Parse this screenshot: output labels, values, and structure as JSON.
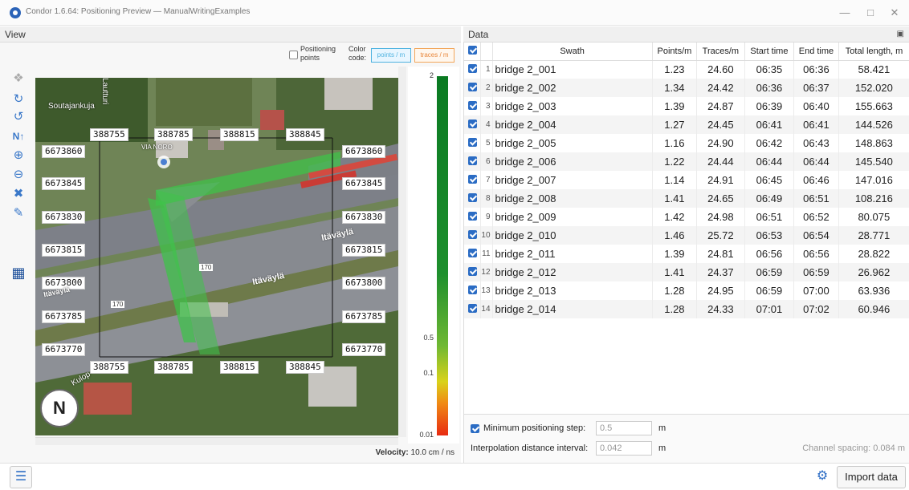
{
  "window": {
    "title": "Condor 1.6.64: Positioning Preview — ManualWritingExamples",
    "minimize": "—",
    "maximize": "□",
    "close": "✕"
  },
  "view_panel": {
    "title": "View",
    "positioning_points_label": "Positioning points",
    "color_code_label": "Color code:",
    "color_code_options": [
      "points / m",
      "traces / m"
    ],
    "velocity_label": "Velocity:",
    "velocity_value": "10.0 cm / ns",
    "colorbar_ticks": [
      "2",
      "0.5",
      "0.1",
      "0.01"
    ],
    "map": {
      "grid_x": [
        "388755",
        "388785",
        "388815",
        "388845"
      ],
      "grid_y": [
        "6673860",
        "6673845",
        "6673830",
        "6673815",
        "6673800",
        "6673785",
        "6673770"
      ],
      "road_labels": [
        "Itäväylä",
        "Itäväylä",
        "Itäväylä"
      ],
      "street_labels": [
        "Soutajankuja",
        "Lautturi",
        "VIA NORO",
        "Kulop"
      ],
      "road_numbers": [
        "170",
        "170"
      ],
      "compass": "N"
    }
  },
  "data_panel": {
    "title": "Data",
    "columns": [
      "Swath",
      "Points/m",
      "Traces/m",
      "Start time",
      "End time",
      "Total length, m"
    ],
    "rows": [
      {
        "idx": "1",
        "swath": "bridge 2_001",
        "points": "1.23",
        "traces": "24.60",
        "start": "06:35",
        "end": "06:36",
        "length": "58.421"
      },
      {
        "idx": "2",
        "swath": "bridge 2_002",
        "points": "1.34",
        "traces": "24.42",
        "start": "06:36",
        "end": "06:37",
        "length": "152.020"
      },
      {
        "idx": "3",
        "swath": "bridge 2_003",
        "points": "1.39",
        "traces": "24.87",
        "start": "06:39",
        "end": "06:40",
        "length": "155.663"
      },
      {
        "idx": "4",
        "swath": "bridge 2_004",
        "points": "1.27",
        "traces": "24.45",
        "start": "06:41",
        "end": "06:41",
        "length": "144.526"
      },
      {
        "idx": "5",
        "swath": "bridge 2_005",
        "points": "1.16",
        "traces": "24.90",
        "start": "06:42",
        "end": "06:43",
        "length": "148.863"
      },
      {
        "idx": "6",
        "swath": "bridge 2_006",
        "points": "1.22",
        "traces": "24.44",
        "start": "06:44",
        "end": "06:44",
        "length": "145.540"
      },
      {
        "idx": "7",
        "swath": "bridge 2_007",
        "points": "1.14",
        "traces": "24.91",
        "start": "06:45",
        "end": "06:46",
        "length": "147.016"
      },
      {
        "idx": "8",
        "swath": "bridge 2_008",
        "points": "1.41",
        "traces": "24.65",
        "start": "06:49",
        "end": "06:51",
        "length": "108.216"
      },
      {
        "idx": "9",
        "swath": "bridge 2_009",
        "points": "1.42",
        "traces": "24.98",
        "start": "06:51",
        "end": "06:52",
        "length": "80.075"
      },
      {
        "idx": "10",
        "swath": "bridge 2_010",
        "points": "1.46",
        "traces": "25.72",
        "start": "06:53",
        "end": "06:54",
        "length": "28.771"
      },
      {
        "idx": "11",
        "swath": "bridge 2_011",
        "points": "1.39",
        "traces": "24.81",
        "start": "06:56",
        "end": "06:56",
        "length": "28.822"
      },
      {
        "idx": "12",
        "swath": "bridge 2_012",
        "points": "1.41",
        "traces": "24.37",
        "start": "06:59",
        "end": "06:59",
        "length": "26.962"
      },
      {
        "idx": "13",
        "swath": "bridge 2_013",
        "points": "1.28",
        "traces": "24.95",
        "start": "06:59",
        "end": "07:00",
        "length": "63.936"
      },
      {
        "idx": "14",
        "swath": "bridge 2_014",
        "points": "1.28",
        "traces": "24.33",
        "start": "07:01",
        "end": "07:02",
        "length": "60.946"
      }
    ],
    "min_step_label": "Minimum positioning step:",
    "min_step_value": "0.5",
    "min_step_unit": "m",
    "interp_label": "Interpolation distance interval:",
    "interp_value": "0.042",
    "interp_unit": "m",
    "channel_spacing": "Channel spacing: 0.084 m"
  },
  "bottom": {
    "import_label": "Import data"
  },
  "colors": {
    "accent": "#2b6cc4",
    "path_green": "#3fc24a"
  }
}
